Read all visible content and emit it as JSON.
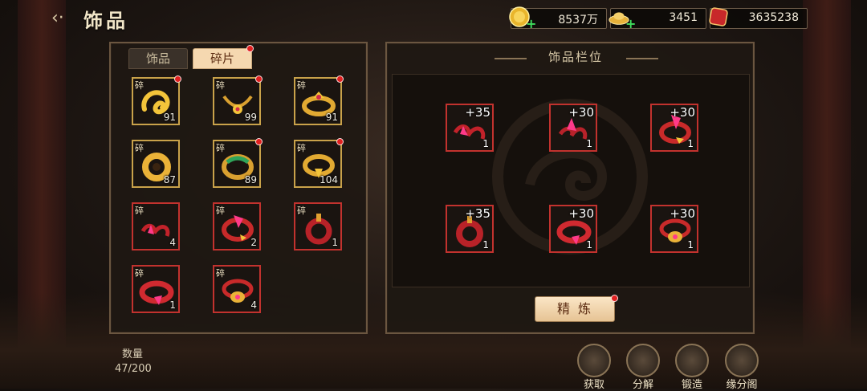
{
  "header": {
    "title": "饰品",
    "resources": [
      {
        "name": "gold-coin",
        "value": "8537万"
      },
      {
        "name": "ingot",
        "value": "3451"
      },
      {
        "name": "red-gem",
        "value": "3635238"
      }
    ]
  },
  "inventory": {
    "tabs": [
      {
        "label": "饰品",
        "active": false
      },
      {
        "label": "碎片",
        "active": true,
        "dot": true
      }
    ],
    "frag_label": "碎",
    "items": [
      {
        "count": "91",
        "rarity": "gold",
        "icon": "gold-dragon-charm",
        "dot": true
      },
      {
        "count": "99",
        "rarity": "gold",
        "icon": "gold-necklace",
        "dot": true
      },
      {
        "count": "91",
        "rarity": "gold",
        "icon": "gold-crown-ring",
        "dot": true
      },
      {
        "count": "87",
        "rarity": "gold",
        "icon": "gold-bracelet",
        "dot": false
      },
      {
        "count": "89",
        "rarity": "gold",
        "icon": "jade-bangle",
        "dot": true
      },
      {
        "count": "104",
        "rarity": "gold",
        "icon": "gold-ring",
        "dot": true
      },
      {
        "count": "4",
        "rarity": "red",
        "icon": "red-crystal-charm",
        "dot": false
      },
      {
        "count": "2",
        "rarity": "red",
        "icon": "red-gem-ring",
        "dot": false
      },
      {
        "count": "1",
        "rarity": "red",
        "icon": "red-amulet",
        "dot": false
      },
      {
        "count": "1",
        "rarity": "red",
        "icon": "red-band-ring",
        "dot": false
      },
      {
        "count": "4",
        "rarity": "red",
        "icon": "red-gold-ring",
        "dot": false
      }
    ],
    "quantity_label": "数量",
    "quantity_value": "47/200"
  },
  "slots": {
    "title": "饰品栏位",
    "items": [
      {
        "level": "+35",
        "count": "1",
        "icon": "red-crystal-charm"
      },
      {
        "level": "+30",
        "count": "1",
        "icon": "red-flower-charm"
      },
      {
        "level": "+30",
        "count": "1",
        "icon": "red-gem-ring"
      },
      {
        "level": "+35",
        "count": "1",
        "icon": "red-amulet"
      },
      {
        "level": "+30",
        "count": "1",
        "icon": "red-band-ring"
      },
      {
        "level": "+30",
        "count": "1",
        "icon": "red-gold-ring"
      }
    ],
    "refine_label": "精炼"
  },
  "actions": [
    {
      "label": "获取",
      "icon": "obtain-icon"
    },
    {
      "label": "分解",
      "icon": "decompose-icon"
    },
    {
      "label": "锻造",
      "icon": "forge-hammer-icon"
    },
    {
      "label": "缘分阁",
      "icon": "pavilion-icon"
    }
  ],
  "colors": {
    "gold_border": "#c9a24a",
    "red_border": "#c2322e",
    "accent_tab": "#f5d8b0"
  }
}
